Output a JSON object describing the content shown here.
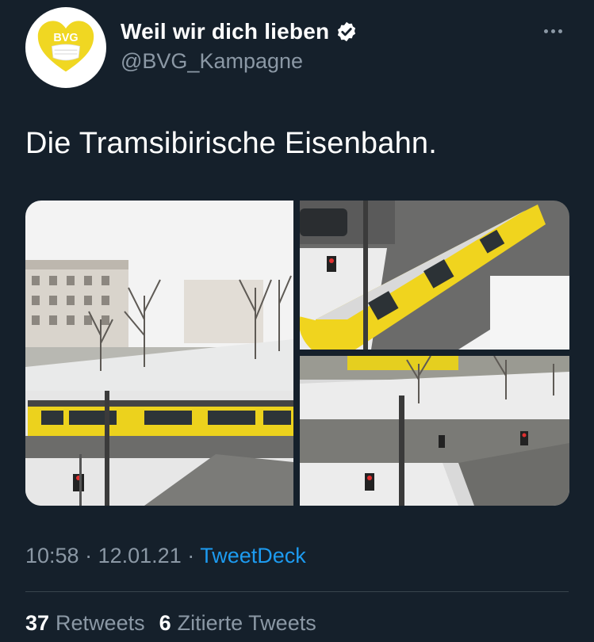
{
  "author": {
    "display_name": "Weil wir dich lieben",
    "handle": "@BVG_Kampagne",
    "avatar_text": "BVG",
    "verified": true
  },
  "tweet": {
    "text": "Die Tramsibirische Eisenbahn."
  },
  "meta": {
    "time": "10:58",
    "separator1": "·",
    "date": "12.01.21",
    "separator2": "·",
    "source": "TweetDeck"
  },
  "stats": {
    "retweets_count": "37",
    "retweets_label": "Retweets",
    "quotes_count": "6",
    "quotes_label": "Zitierte Tweets"
  },
  "colors": {
    "background": "#15202b",
    "muted": "#8b98a5",
    "link": "#1d9bf0",
    "brand_yellow": "#f0d722"
  }
}
